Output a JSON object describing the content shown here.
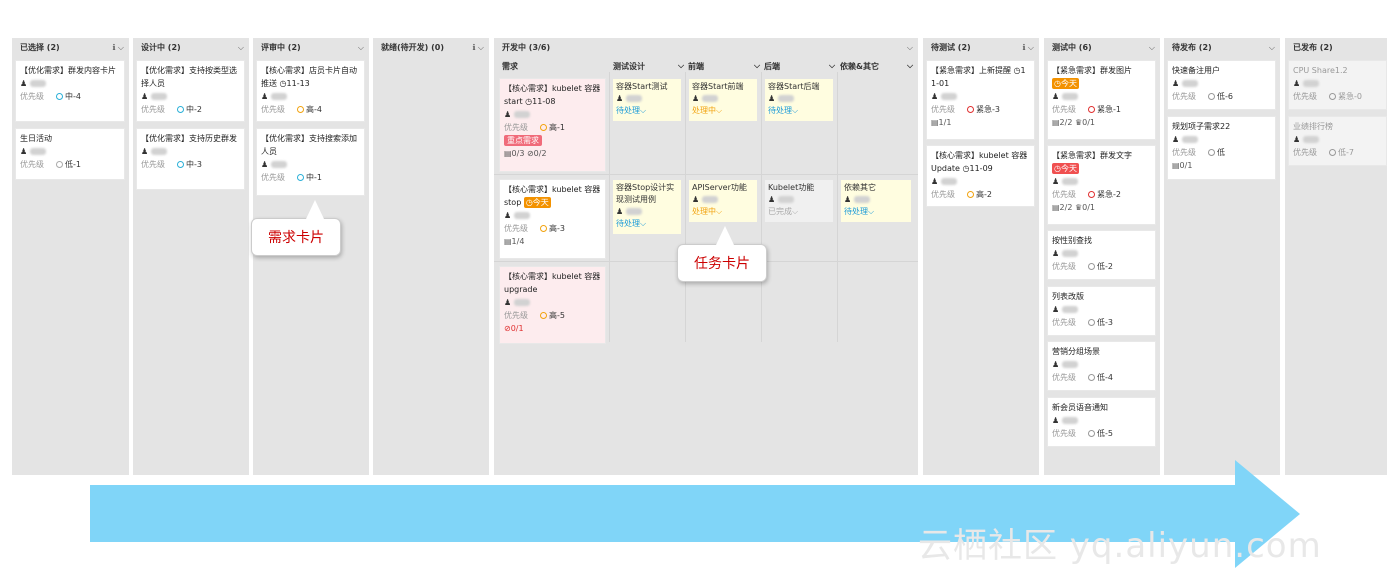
{
  "columns": [
    {
      "id": "selected",
      "title": "已选择 (2)",
      "icons": "ℹ ⌵"
    },
    {
      "id": "designing",
      "title": "设计中 (2)",
      "icons": "⌵"
    },
    {
      "id": "reviewing",
      "title": "评审中 (2)",
      "icons": "⌵"
    },
    {
      "id": "ready",
      "title": "就绪(待开发) (0)",
      "icons": "ℹ ⌵"
    },
    {
      "id": "developing",
      "title": "开发中 (3/6)",
      "icons": "⌵"
    },
    {
      "id": "to_test",
      "title": "待测试 (2)",
      "icons": "ℹ ⌵"
    },
    {
      "id": "testing",
      "title": "测试中 (6)",
      "icons": "⌵"
    },
    {
      "id": "to_release",
      "title": "待发布 (2)",
      "icons": "⌵"
    },
    {
      "id": "released",
      "title": "已发布 (2)",
      "icons": ""
    }
  ],
  "swimlane_headers": {
    "req": "需求",
    "test": "测试设计",
    "front": "前端",
    "back": "后端",
    "dep": "依赖&其它",
    "chev": "⌵"
  },
  "labels": {
    "priority": "优先级",
    "person_icon": "person-icon",
    "todo": "待处理⌵",
    "doing": "处理中⌵",
    "done": "已完成⌵"
  },
  "cards": {
    "c1": {
      "title": "【优化需求】群发内容卡片",
      "pri": "中-4"
    },
    "c2": {
      "title": "生日活动",
      "pri": "低-1"
    },
    "c3": {
      "title": "【优化需求】支持按类型选择人员",
      "pri": "中-2"
    },
    "c4": {
      "title": "【优化需求】支持历史群发",
      "pri": "中-3"
    },
    "c5": {
      "title": "【核心需求】店员卡片自动推送 ◷11-13",
      "pri": "高-4"
    },
    "c6": {
      "title": "【优化需求】支持搜索添加人员",
      "pri": "中-1"
    },
    "c7": {
      "title": "【核心需求】kubelet 容器start ◷11-08",
      "pri": "高-1",
      "tag": "重点需求",
      "sub": "▤0/3 ⊘0/2"
    },
    "c8": {
      "title": "【核心需求】kubelet 容器stop",
      "today": "◷今天",
      "pri": "高-3",
      "sub": "▤1/4"
    },
    "c9": {
      "title": "【核心需求】kubelet 容器upgrade",
      "pri": "高-5",
      "sub": "⊘0/1"
    },
    "c10": {
      "title": "【紧急需求】上新提醒 ◷11-01",
      "pri": "紧急-3",
      "sub": "▤1/1"
    },
    "c11": {
      "title": "【核心需求】kubelet 容器Update ◷11-09",
      "pri": "高-2"
    },
    "c12": {
      "title": "【紧急需求】群发图片",
      "today": "◷今天",
      "pri": "紧急-1",
      "sub": "▤2/2 ♛0/1"
    },
    "c13": {
      "title": "【紧急需求】群发文字",
      "today": "◷今天",
      "pri": "紧急-2",
      "sub": "▤2/2 ♛0/1"
    },
    "c14": {
      "title": "按性别查找",
      "pri": "低-2"
    },
    "c15": {
      "title": "列表改版",
      "pri": "低-3"
    },
    "c16": {
      "title": "营销分组场景",
      "pri": "低-4"
    },
    "c17": {
      "title": "新会员语音通知",
      "pri": "低-5"
    },
    "c18": {
      "title": "快速备注用户",
      "pri": "低-6"
    },
    "c19": {
      "title": "规划项子需求22",
      "pri": "低",
      "sub": "▤0/1"
    },
    "c20": {
      "title": "CPU Share1.2",
      "pri": "紧急-0"
    },
    "c21": {
      "title": "业绩排行榜",
      "pri": "低-7"
    }
  },
  "tasks": {
    "t1": "容器Start测试",
    "t2": "容器Start前端",
    "t3": "容器Start后端",
    "t4": "容器Stop设计实现测试用例",
    "t5": "APIServer功能",
    "t6": "Kubelet功能",
    "t7": "依赖其它"
  },
  "callouts": {
    "req": "需求卡片",
    "task": "任务卡片"
  },
  "watermark": "云栖社区 yq.aliyun.com",
  "colors": {
    "high": "#f2a30f",
    "urgent": "#e03030",
    "mid": "#2ab0d8",
    "low": "#aaaaaa",
    "arrow": "#80d5f8"
  }
}
